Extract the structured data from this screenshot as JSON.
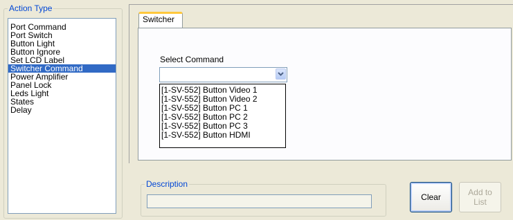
{
  "action_type": {
    "title": "Action Type",
    "items": [
      {
        "label": "Port Command",
        "selected": false
      },
      {
        "label": "Port Switch",
        "selected": false
      },
      {
        "label": "Button Light",
        "selected": false
      },
      {
        "label": "Button Ignore",
        "selected": false
      },
      {
        "label": "Set LCD Label",
        "selected": false
      },
      {
        "label": "Switcher Command",
        "selected": true
      },
      {
        "label": "Power Amplifier",
        "selected": false
      },
      {
        "label": "Panel Lock",
        "selected": false
      },
      {
        "label": "Leds Light",
        "selected": false
      },
      {
        "label": "States",
        "selected": false
      },
      {
        "label": "Delay",
        "selected": false
      }
    ]
  },
  "tab": {
    "label": "Switcher",
    "select_command_label": "Select Command",
    "select_value": "",
    "options": [
      "[1-SV-552] Button Video 1",
      "[1-SV-552] Button Video 2",
      "[1-SV-552] Button PC 1",
      "[1-SV-552] Button PC 2",
      "[1-SV-552] Button PC 3",
      "[1-SV-552] Button HDMI"
    ]
  },
  "description": {
    "title": "Description",
    "value": ""
  },
  "buttons": {
    "clear": "Clear",
    "add_to_list": "Add to List"
  },
  "colors": {
    "accent": "#316ac5",
    "group_title": "#0046d5",
    "tab_highlight": "#ffc83c"
  }
}
